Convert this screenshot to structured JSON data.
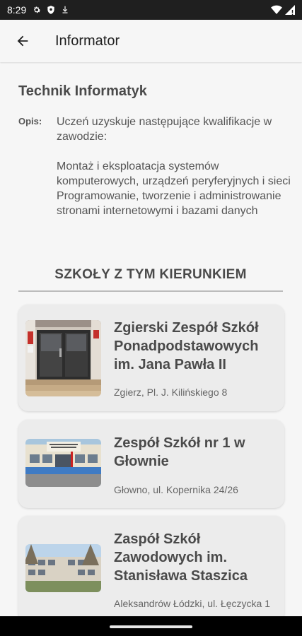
{
  "status_bar": {
    "time": "8:29",
    "icons": [
      "gear-icon",
      "shield-icon",
      "download-icon",
      "wifi-icon",
      "signal-icon"
    ]
  },
  "app_bar": {
    "title": "Informator",
    "back_icon": "arrow-back-icon"
  },
  "course": {
    "title": "Technik Informatyk",
    "description_label": "Opis:",
    "description": "Uczeń uzyskuje następujące kwalifikacje w zawodzie:\n\nMontaż i eksploatacja systemów komputerowych, urządzeń peryferyjnych i sieci\nProgramowanie, tworzenie i administrowanie stronami internetowymi i bazami danych"
  },
  "schools_section": {
    "heading": "SZKOŁY Z TYM KIERUNKIEM",
    "schools": [
      {
        "name": "Zgierski Zespół Szkół Ponadpodstawowych im. Jana Pawła II",
        "address": "Zgierz, Pl. J. Kilińskiego 8"
      },
      {
        "name": "Zespół Szkół nr 1 w Głownie",
        "address": "Głowno, ul. Kopernika 24/26"
      },
      {
        "name": "Zaspół Szkół Zawodowych im. Stanisława Staszica",
        "address": "Aleksandrów Łódzki, ul. Łęczycka 1"
      }
    ]
  },
  "colors": {
    "background": "#f6f6f6",
    "card": "#ececec",
    "status_bar": "#1f1f1f",
    "text_primary": "#4a4a4a"
  }
}
